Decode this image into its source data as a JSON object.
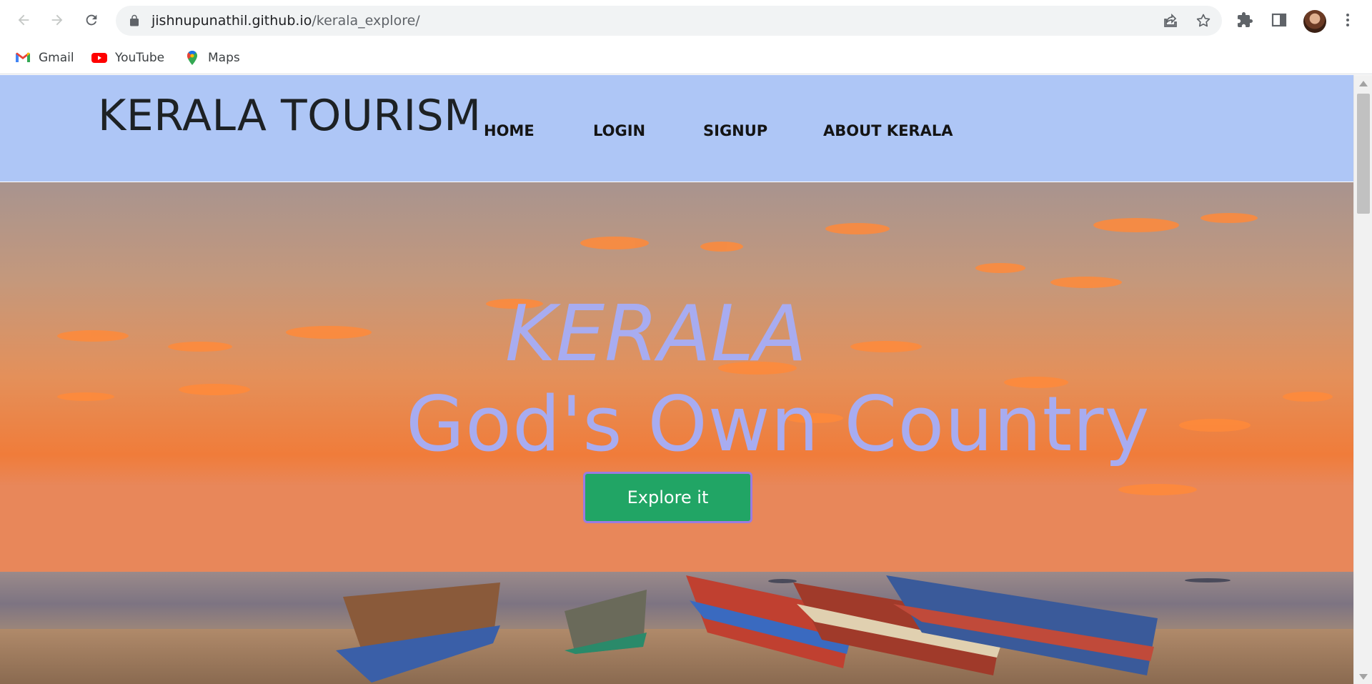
{
  "browser": {
    "url_host": "jishnupunathil.github.io",
    "url_path": "/kerala_explore/",
    "bookmarks": [
      {
        "label": "Gmail",
        "icon": "gmail-icon"
      },
      {
        "label": "YouTube",
        "icon": "youtube-icon"
      },
      {
        "label": "Maps",
        "icon": "maps-icon"
      }
    ]
  },
  "site": {
    "brand": "KERALA TOURISM",
    "nav": [
      "HOME",
      "LOGIN",
      "SIGNUP",
      "ABOUT KERALA"
    ],
    "header_bg": "#aec6f6"
  },
  "hero": {
    "title": "KERALA",
    "subtitle": "God's Own Country",
    "cta": "Explore it",
    "text_color": "#a8acf0",
    "cta_color": "#21a565"
  }
}
